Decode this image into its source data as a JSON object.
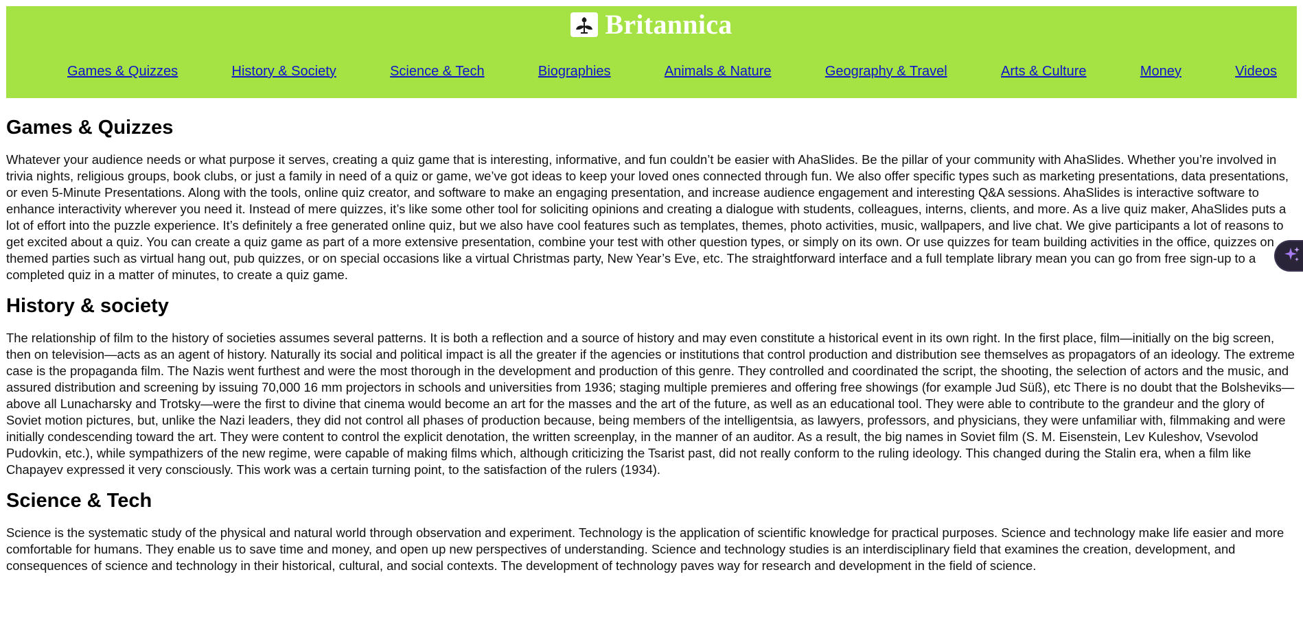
{
  "brand": {
    "name": "Britannica",
    "logo_icon": "thistle-icon"
  },
  "nav": {
    "items": [
      "Games & Quizzes",
      "History & Society",
      "Science & Tech",
      "Biographies",
      "Animals & Nature",
      "Geography & Travel",
      "Arts & Culture",
      "Money",
      "Videos"
    ]
  },
  "sections": [
    {
      "title": "Games & Quizzes",
      "text": "Whatever your audience needs or what purpose it serves, creating a quiz game that is interesting, informative, and fun couldn’t be easier with AhaSlides. Be the pillar of your community with AhaSlides. Whether you’re involved in trivia nights, religious groups, book clubs, or just a family in need of a quiz or game, we’ve got ideas to keep your loved ones connected through fun. We also offer specific types such as marketing presentations, data presentations, or even 5-Minute Presentations. Along with the tools, online quiz creator, and software to make an engaging presentation, and increase audience engagement and interesting Q&A sessions. AhaSlides is interactive software to enhance interactivity wherever you need it. Instead of mere quizzes, it’s like some other tool for soliciting opinions and creating a dialogue with students, colleagues, interns, clients, and more. As a live quiz maker, AhaSlides puts a lot of effort into the puzzle experience. It’s definitely a free generated online quiz, but we also have cool features such as templates, themes, photo activities, music, wallpapers, and live chat. We give participants a lot of reasons to get excited about a quiz. You can create a quiz game as part of a more extensive presentation, combine your test with other question types, or simply on its own. Or use quizzes for team building activities in the office, quizzes on themed parties such as virtual hang out, pub quizzes, or on special occasions like a virtual Christmas party, New Year’s Eve, etc. The straightforward interface and a full template library mean you can go from free sign-up to a completed quiz in a matter of minutes, to create a quiz game."
    },
    {
      "title": "History & society",
      "text": "The relationship of film to the history of societies assumes several patterns. It is both a reflection and a source of history and may even constitute a historical event in its own right. In the first place, film—initially on the big screen, then on television—acts as an agent of history. Naturally its social and political impact is all the greater if the agencies or institutions that control production and distribution see themselves as propagators of an ideology. The extreme case is the propaganda film. The Nazis went furthest and were the most thorough in the development and production of this genre. They controlled and coordinated the script, the shooting, the selection of actors and the music, and assured distribution and screening by issuing 70,000 16 mm projectors in schools and universities from 1936; staging multiple premieres and offering free showings (for example Jud Süß), etc There is no doubt that the Bolsheviks—above all Lunacharsky and Trotsky—were the first to divine that cinema would become an art for the masses and the art of the future, as well as an educational tool. They were able to contribute to the grandeur and the glory of Soviet motion pictures, but, unlike the Nazi leaders, they did not control all phases of production because, being members of the intelligentsia, as lawyers, professors, and physicians, they were unfamiliar with, filmmaking and were initially condescending toward the art. They were content to control the explicit denotation, the written screenplay, in the manner of an auditor. As a result, the big names in Soviet film (S. M. Eisenstein, Lev Kuleshov, Vsevolod Pudovkin, etc.), while sympathizers of the new regime, were capable of making films which, although criticizing the Tsarist past, did not really conform to the ruling ideology. This changed during the Stalin era, when a film like Chapayev expressed it very consciously. This work was a certain turning point, to the satisfaction of the rulers (1934)."
    },
    {
      "title": "Science & Tech",
      "text": "Science is the systematic study of the physical and natural world through observation and experiment. Technology is the application of scientific knowledge for practical purposes. Science and technology make life easier and more comfortable for humans. They enable us to save time and money, and open up new perspectives of understanding. Science and technology studies is an interdisciplinary field that examines the creation, development, and consequences of science and technology in their historical, cultural, and social contexts. The development of technology paves way for research and development in the field of science."
    }
  ],
  "widget": {
    "icon": "sparkle-icon",
    "accent": "#a77bf3"
  },
  "colors": {
    "header_bg": "#a5e344",
    "link": "#0d14c9"
  }
}
